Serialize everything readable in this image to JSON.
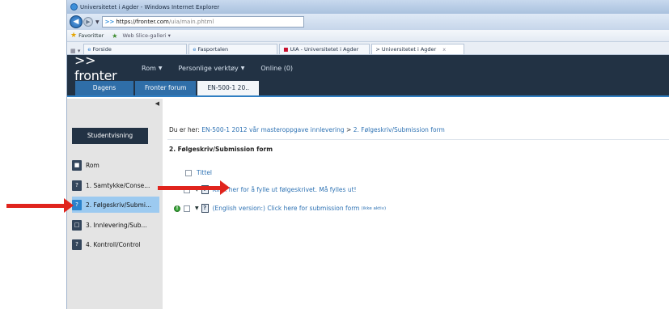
{
  "browser": {
    "window_title": "Universitetet i Agder - Windows Internet Explorer",
    "url_host": "https://fronter.com",
    "url_path": "/uia/main.phtml",
    "favorites_label": "Favoritter",
    "web_slice_label": "Web Slice-galleri",
    "tabs": [
      {
        "label": "Forside"
      },
      {
        "label": "Fasportalen"
      },
      {
        "label": "UiA - Universitetet i Agder"
      },
      {
        "label": "> Universitetet i Agder"
      }
    ],
    "tab_close": "x"
  },
  "fronter": {
    "logo": ">> fronter",
    "menu": [
      {
        "label": "Rom"
      },
      {
        "label": "Personlige verktøy"
      },
      {
        "label": "Online (0)"
      }
    ],
    "subtabs": [
      {
        "label": "Dagens"
      },
      {
        "label": "Fronter forum"
      },
      {
        "label": "EN-500-1 20.."
      }
    ]
  },
  "sidebar": {
    "student_view": "Studentvisning",
    "items": [
      {
        "label": "Rom",
        "icon": "room-icon"
      },
      {
        "label": "1. Samtykke/Conse...",
        "icon": "document-icon"
      },
      {
        "label": "2. Følgeskriv/Submi...",
        "icon": "document-icon"
      },
      {
        "label": "3. Innlevering/Sub...",
        "icon": "folder-icon"
      },
      {
        "label": "4. Kontroll/Control",
        "icon": "document-icon"
      }
    ]
  },
  "main": {
    "breadcrumb_prefix": "Du er her:",
    "breadcrumb_link": "EN-500-1 2012 vår masteroppgave innlevering",
    "breadcrumb_sep": ">",
    "breadcrumb_current": "2. Følgeskriv/Submission form",
    "title": "2. Følgeskriv/Submission form",
    "column_title": "Tittel",
    "rows": [
      {
        "label": "Klikk her for å fylle ut følgeskrivet. Må fylles ut!",
        "suffix": ""
      },
      {
        "label": "(English version:) Click here for submission form",
        "suffix": "(ikke aktiv)"
      }
    ]
  },
  "colors": {
    "annotation_arrow": "#e0241d",
    "header_bg": "#223244",
    "active_tab": "#2f6ea8",
    "link": "#2f73b4",
    "active_sidebar": "#9ccaf0"
  }
}
